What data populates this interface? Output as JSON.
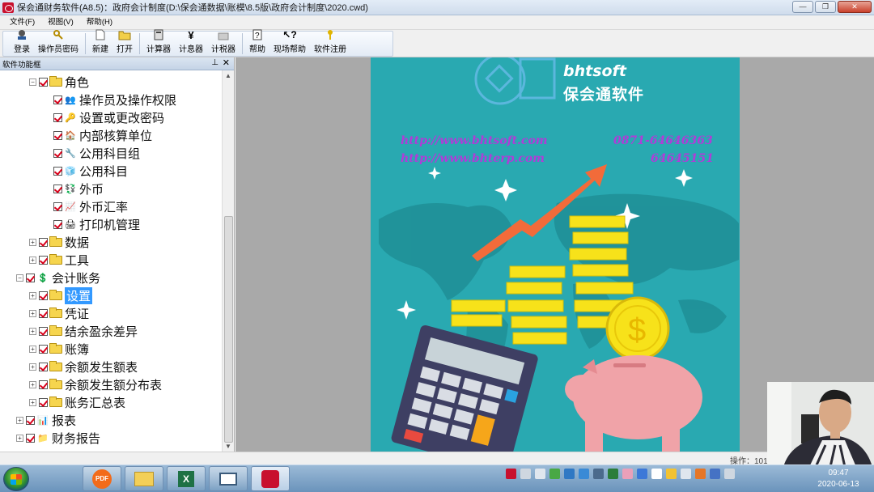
{
  "window": {
    "title": "保会通财务软件(A8.5)：政府会计制度(D:\\保会通数据\\账模\\8.5版\\政府会计制度\\2020.cwd)",
    "controls": [
      "—",
      "❐",
      "✕"
    ]
  },
  "menu": [
    "文件(F)",
    "视图(V)",
    "帮助(H)"
  ],
  "toolbar": {
    "buttons": [
      "登录",
      "操作员密码",
      "新建",
      "打开",
      "计算器",
      "计息器",
      "计税器",
      "帮助",
      "现场帮助",
      "软件注册"
    ]
  },
  "panel": {
    "title": "软件功能框",
    "pin": "📌",
    "close": "✕"
  },
  "tree": [
    {
      "label": "角色",
      "level": 1,
      "expander": "−",
      "icon": "folder-icon"
    },
    {
      "label": "操作员及操作权限",
      "level": 2,
      "icon": "users-icon"
    },
    {
      "label": "设置或更改密码",
      "level": 2,
      "icon": "key-icon"
    },
    {
      "label": "内部核算单位",
      "level": 2,
      "icon": "house-icon"
    },
    {
      "label": "公用科目组",
      "level": 2,
      "icon": "tools-icon"
    },
    {
      "label": "公用科目",
      "level": 2,
      "icon": "cube-icon"
    },
    {
      "label": "外币",
      "level": 2,
      "icon": "currency-icon"
    },
    {
      "label": "外币汇率",
      "level": 2,
      "icon": "exchange-icon"
    },
    {
      "label": "打印机管理",
      "level": 2,
      "icon": "printer-icon"
    },
    {
      "label": "数据",
      "level": 1,
      "expander": "+",
      "icon": "folder-icon"
    },
    {
      "label": "工具",
      "level": 1,
      "expander": "+",
      "icon": "folder-icon"
    },
    {
      "label": "会计账务",
      "level": 0,
      "expander": "−",
      "icon": "money-icon"
    },
    {
      "label": "设置",
      "level": 1,
      "expander": "+",
      "icon": "folder-icon",
      "selected": true
    },
    {
      "label": "凭证",
      "level": 1,
      "expander": "+",
      "icon": "folder-icon"
    },
    {
      "label": "结余盈余差异",
      "level": 1,
      "expander": "+",
      "icon": "folder-icon"
    },
    {
      "label": "账簿",
      "level": 1,
      "expander": "+",
      "icon": "folder-icon"
    },
    {
      "label": "余额发生额表",
      "level": 1,
      "expander": "+",
      "icon": "folder-icon"
    },
    {
      "label": "余额发生额分布表",
      "level": 1,
      "expander": "+",
      "icon": "folder-icon"
    },
    {
      "label": "账务汇总表",
      "level": 1,
      "expander": "+",
      "icon": "folder-icon"
    },
    {
      "label": "报表",
      "level": 0,
      "expander": "+",
      "icon": "report-icon"
    },
    {
      "label": "财务报告",
      "level": 0,
      "expander": "+",
      "icon": "finance-icon"
    }
  ],
  "poster": {
    "brand": "bhtsoft",
    "brand_cn": "保会通软件",
    "url1": "http://www.bhtsoft.com",
    "url2": "http://www.bhterp.com",
    "phone1": "0871-64646363",
    "phone2": "64645151",
    "colors": {
      "background": "#29a9b1",
      "gold": "#f7e21a",
      "pig": "#f0a3a8",
      "arrow": "#f26b3a"
    }
  },
  "status": {
    "text": "操作：101"
  },
  "taskbar": {
    "apps": [
      "pdf-icon",
      "explorer-icon",
      "excel-icon",
      "window-icon",
      "bht-app-icon"
    ],
    "time": "09:47",
    "date": "2020-06-13"
  }
}
